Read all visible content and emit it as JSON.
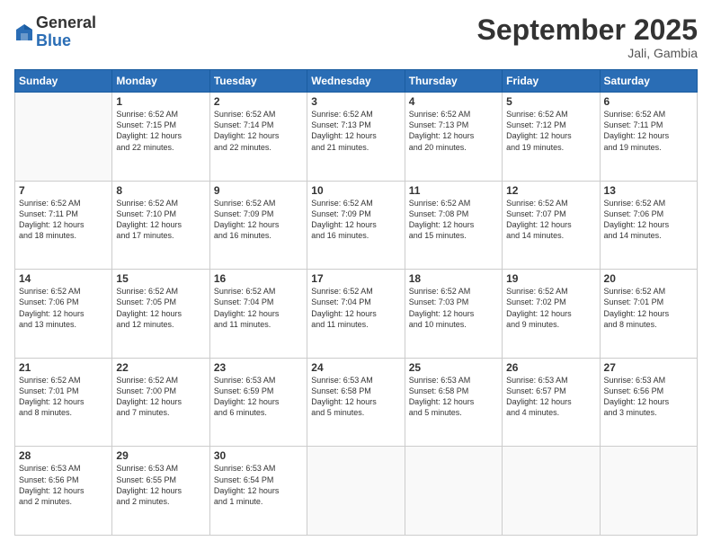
{
  "logo": {
    "general": "General",
    "blue": "Blue"
  },
  "title": "September 2025",
  "location": "Jali, Gambia",
  "days_header": [
    "Sunday",
    "Monday",
    "Tuesday",
    "Wednesday",
    "Thursday",
    "Friday",
    "Saturday"
  ],
  "weeks": [
    [
      {
        "day": "",
        "info": ""
      },
      {
        "day": "1",
        "info": "Sunrise: 6:52 AM\nSunset: 7:15 PM\nDaylight: 12 hours\nand 22 minutes."
      },
      {
        "day": "2",
        "info": "Sunrise: 6:52 AM\nSunset: 7:14 PM\nDaylight: 12 hours\nand 22 minutes."
      },
      {
        "day": "3",
        "info": "Sunrise: 6:52 AM\nSunset: 7:13 PM\nDaylight: 12 hours\nand 21 minutes."
      },
      {
        "day": "4",
        "info": "Sunrise: 6:52 AM\nSunset: 7:13 PM\nDaylight: 12 hours\nand 20 minutes."
      },
      {
        "day": "5",
        "info": "Sunrise: 6:52 AM\nSunset: 7:12 PM\nDaylight: 12 hours\nand 19 minutes."
      },
      {
        "day": "6",
        "info": "Sunrise: 6:52 AM\nSunset: 7:11 PM\nDaylight: 12 hours\nand 19 minutes."
      }
    ],
    [
      {
        "day": "7",
        "info": "Sunrise: 6:52 AM\nSunset: 7:11 PM\nDaylight: 12 hours\nand 18 minutes."
      },
      {
        "day": "8",
        "info": "Sunrise: 6:52 AM\nSunset: 7:10 PM\nDaylight: 12 hours\nand 17 minutes."
      },
      {
        "day": "9",
        "info": "Sunrise: 6:52 AM\nSunset: 7:09 PM\nDaylight: 12 hours\nand 16 minutes."
      },
      {
        "day": "10",
        "info": "Sunrise: 6:52 AM\nSunset: 7:09 PM\nDaylight: 12 hours\nand 16 minutes."
      },
      {
        "day": "11",
        "info": "Sunrise: 6:52 AM\nSunset: 7:08 PM\nDaylight: 12 hours\nand 15 minutes."
      },
      {
        "day": "12",
        "info": "Sunrise: 6:52 AM\nSunset: 7:07 PM\nDaylight: 12 hours\nand 14 minutes."
      },
      {
        "day": "13",
        "info": "Sunrise: 6:52 AM\nSunset: 7:06 PM\nDaylight: 12 hours\nand 14 minutes."
      }
    ],
    [
      {
        "day": "14",
        "info": "Sunrise: 6:52 AM\nSunset: 7:06 PM\nDaylight: 12 hours\nand 13 minutes."
      },
      {
        "day": "15",
        "info": "Sunrise: 6:52 AM\nSunset: 7:05 PM\nDaylight: 12 hours\nand 12 minutes."
      },
      {
        "day": "16",
        "info": "Sunrise: 6:52 AM\nSunset: 7:04 PM\nDaylight: 12 hours\nand 11 minutes."
      },
      {
        "day": "17",
        "info": "Sunrise: 6:52 AM\nSunset: 7:04 PM\nDaylight: 12 hours\nand 11 minutes."
      },
      {
        "day": "18",
        "info": "Sunrise: 6:52 AM\nSunset: 7:03 PM\nDaylight: 12 hours\nand 10 minutes."
      },
      {
        "day": "19",
        "info": "Sunrise: 6:52 AM\nSunset: 7:02 PM\nDaylight: 12 hours\nand 9 minutes."
      },
      {
        "day": "20",
        "info": "Sunrise: 6:52 AM\nSunset: 7:01 PM\nDaylight: 12 hours\nand 8 minutes."
      }
    ],
    [
      {
        "day": "21",
        "info": "Sunrise: 6:52 AM\nSunset: 7:01 PM\nDaylight: 12 hours\nand 8 minutes."
      },
      {
        "day": "22",
        "info": "Sunrise: 6:52 AM\nSunset: 7:00 PM\nDaylight: 12 hours\nand 7 minutes."
      },
      {
        "day": "23",
        "info": "Sunrise: 6:53 AM\nSunset: 6:59 PM\nDaylight: 12 hours\nand 6 minutes."
      },
      {
        "day": "24",
        "info": "Sunrise: 6:53 AM\nSunset: 6:58 PM\nDaylight: 12 hours\nand 5 minutes."
      },
      {
        "day": "25",
        "info": "Sunrise: 6:53 AM\nSunset: 6:58 PM\nDaylight: 12 hours\nand 5 minutes."
      },
      {
        "day": "26",
        "info": "Sunrise: 6:53 AM\nSunset: 6:57 PM\nDaylight: 12 hours\nand 4 minutes."
      },
      {
        "day": "27",
        "info": "Sunrise: 6:53 AM\nSunset: 6:56 PM\nDaylight: 12 hours\nand 3 minutes."
      }
    ],
    [
      {
        "day": "28",
        "info": "Sunrise: 6:53 AM\nSunset: 6:56 PM\nDaylight: 12 hours\nand 2 minutes."
      },
      {
        "day": "29",
        "info": "Sunrise: 6:53 AM\nSunset: 6:55 PM\nDaylight: 12 hours\nand 2 minutes."
      },
      {
        "day": "30",
        "info": "Sunrise: 6:53 AM\nSunset: 6:54 PM\nDaylight: 12 hours\nand 1 minute."
      },
      {
        "day": "",
        "info": ""
      },
      {
        "day": "",
        "info": ""
      },
      {
        "day": "",
        "info": ""
      },
      {
        "day": "",
        "info": ""
      }
    ]
  ]
}
